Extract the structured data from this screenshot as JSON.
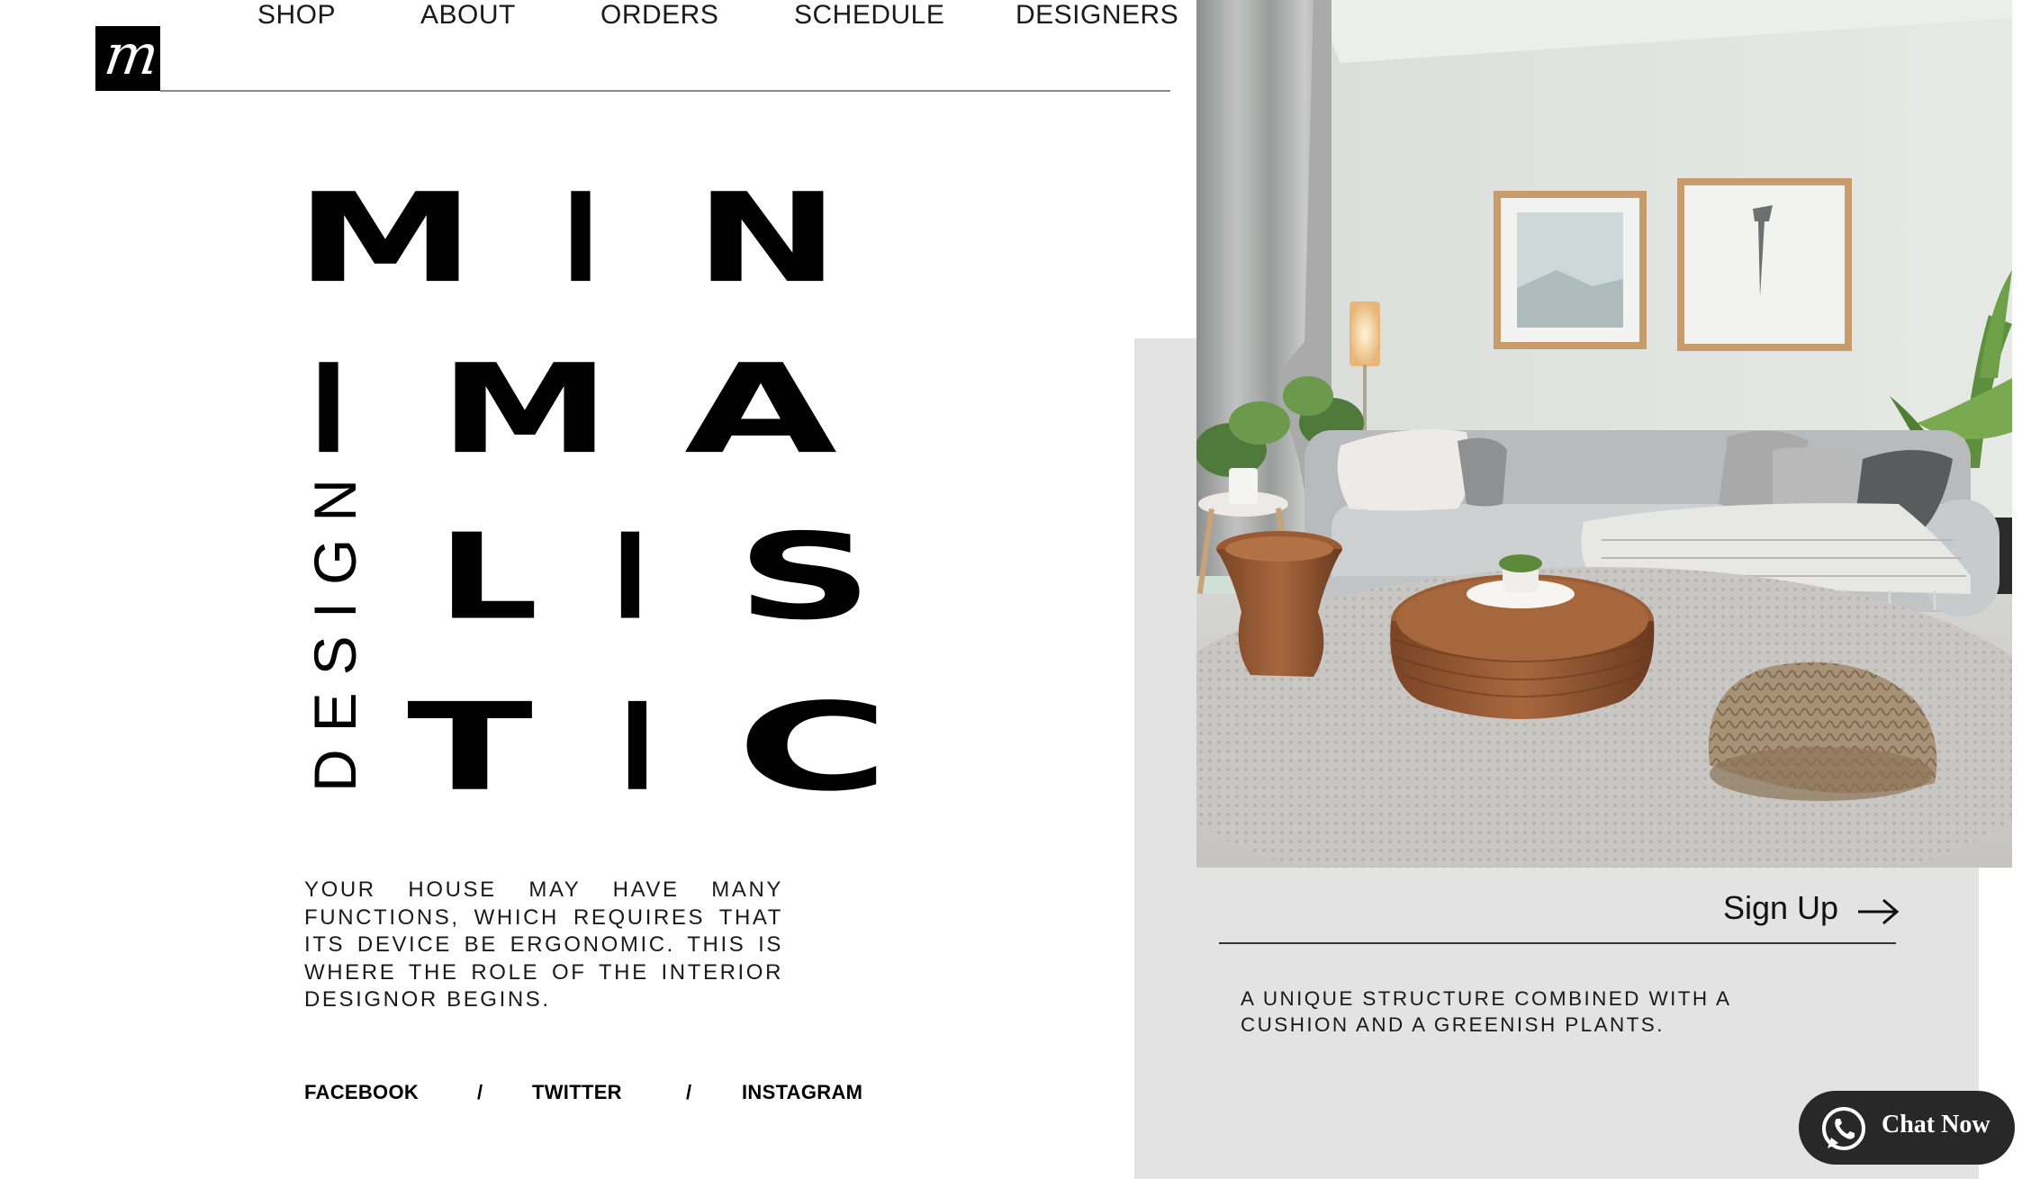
{
  "brand": {
    "logo_letter": "m"
  },
  "nav": {
    "items": [
      {
        "label": "SHOP"
      },
      {
        "label": "ABOUT"
      },
      {
        "label": "ORDERS"
      },
      {
        "label": "SCHEDULE"
      },
      {
        "label": "DESIGNERS"
      }
    ]
  },
  "hero": {
    "lines": [
      "MIN",
      "IMA",
      "LIS",
      "TIC"
    ],
    "vertical_word": "DESIGN",
    "description": "YOUR HOUSE MAY HAVE MANY FUNCTIONS, WHICH REQUIRES THAT ITS DEVICE BE ERGONOMIC. THIS IS WHERE THE ROLE OF THE INTERIOR DESIGNOR BEGINS."
  },
  "social": {
    "facebook": "FACEBOOK",
    "twitter": "TWITTER",
    "instagram": "INSTAGRAM",
    "separator": "/"
  },
  "feature": {
    "signup_label": "Sign Up",
    "caption": "A UNIQUE STRUCTURE COMBINED WITH A CUSHION AND A GREENISH PLANTS."
  },
  "chat": {
    "label": "Chat Now"
  },
  "colors": {
    "text": "#000000",
    "panel": "#e3e3e3",
    "chat_bg": "#282828",
    "rule": "#8a8a8a"
  }
}
